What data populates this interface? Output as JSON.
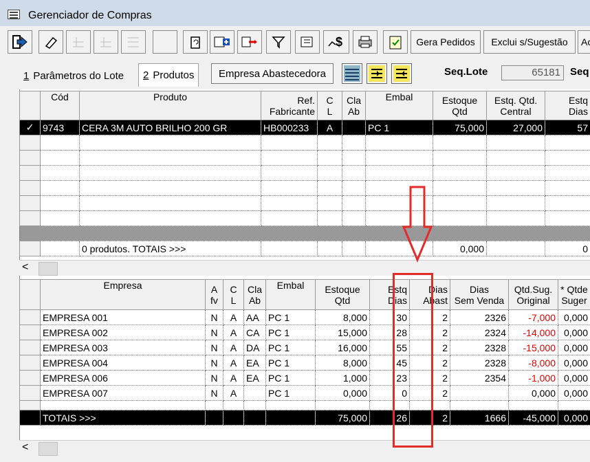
{
  "window": {
    "title": "Gerenciador de Compras"
  },
  "toolbar": {
    "icons": [
      "exit-icon",
      "eraser-icon",
      "disabled-icon",
      "disabled-icon",
      "disabled-icon",
      "blank-icon",
      "refresh-icon",
      "add-icon",
      "remove-icon",
      "filter-icon",
      "edit-icon",
      "money-icon",
      "print-icon",
      "checklist-icon"
    ],
    "gera_pedidos": "Gera Pedidos",
    "exclui_sugestao": "Exclui s/Sugestão",
    "cut_label": "Ac"
  },
  "tabs": [
    {
      "num": "1",
      "label": "Parâmetros do Lote"
    },
    {
      "num": "2",
      "label": "Produtos"
    }
  ],
  "empresa_button": "Empresa Abastecedora",
  "seq": {
    "label": "Seq.Lote",
    "value": "65181",
    "label2": "Seq"
  },
  "top_grid": {
    "headers": [
      "Cód",
      "Produto",
      "Ref.\nFabricante",
      "C\nL",
      "Cla\nAb",
      "Embal",
      "Estoque\nQtd",
      "Estq. Qtd.\nCentral",
      "Estq\nDias"
    ],
    "selected_row": {
      "check": "✓",
      "cod": "9743",
      "produto": "CERA 3M AUTO BRILHO 200 GR",
      "ref": "HB000233",
      "cl": "A",
      "claab": "",
      "embal": "PC 1",
      "estoque": "75,000",
      "central": "27,000",
      "dias": "57"
    },
    "totals": {
      "label": "0 produtos. TOTAIS >>>",
      "estoque": "0,000",
      "dias": "0"
    }
  },
  "bottom_grid": {
    "headers": [
      "Empresa",
      "A\nfv",
      "C\nL",
      "Cla\nAb",
      "Embal",
      "Estoque\nQtd",
      "Estq\nDias",
      "Dias\nAbast",
      "Dias\nSem Venda",
      "Qtd.Sug.\nOriginal",
      "* Qtde\nSuger"
    ],
    "rows": [
      {
        "empresa": "EMPRESA 001",
        "afv": "N",
        "cl": "A",
        "claab": "AA",
        "embal": "PC 1",
        "estoque": "8,000",
        "estqdias": "30",
        "abast": "2",
        "semvenda": "2326",
        "sug": "-7,000",
        "qtde": "0,000"
      },
      {
        "empresa": "EMPRESA 002",
        "afv": "N",
        "cl": "A",
        "claab": "CA",
        "embal": "PC 1",
        "estoque": "15,000",
        "estqdias": "28",
        "abast": "2",
        "semvenda": "2324",
        "sug": "-14,000",
        "qtde": "0,000"
      },
      {
        "empresa": "EMPRESA 003",
        "afv": "N",
        "cl": "A",
        "claab": "DA",
        "embal": "PC 1",
        "estoque": "16,000",
        "estqdias": "55",
        "abast": "2",
        "semvenda": "2328",
        "sug": "-15,000",
        "qtde": "0,000"
      },
      {
        "empresa": "EMPRESA 004",
        "afv": "N",
        "cl": "A",
        "claab": "EA",
        "embal": "PC 1",
        "estoque": "8,000",
        "estqdias": "45",
        "abast": "2",
        "semvenda": "2328",
        "sug": "-8,000",
        "qtde": "0,000"
      },
      {
        "empresa": "EMPRESA 006",
        "afv": "N",
        "cl": "A",
        "claab": "EA",
        "embal": "PC 1",
        "estoque": "1,000",
        "estqdias": "23",
        "abast": "2",
        "semvenda": "2354",
        "sug": "-1,000",
        "qtde": "0,000"
      },
      {
        "empresa": "EMPRESA 007",
        "afv": "N",
        "cl": "A",
        "claab": "",
        "embal": "PC 1",
        "estoque": "0,000",
        "estqdias": "0",
        "abast": "2",
        "semvenda": "",
        "sug": "0,000",
        "qtde": "0,000"
      }
    ],
    "totals": {
      "label": "TOTAIS >>>",
      "estoque": "75,000",
      "estqdias": "26",
      "abast": "2",
      "semvenda": "1666",
      "sug": "-45,000",
      "qtde": "0,000"
    }
  }
}
